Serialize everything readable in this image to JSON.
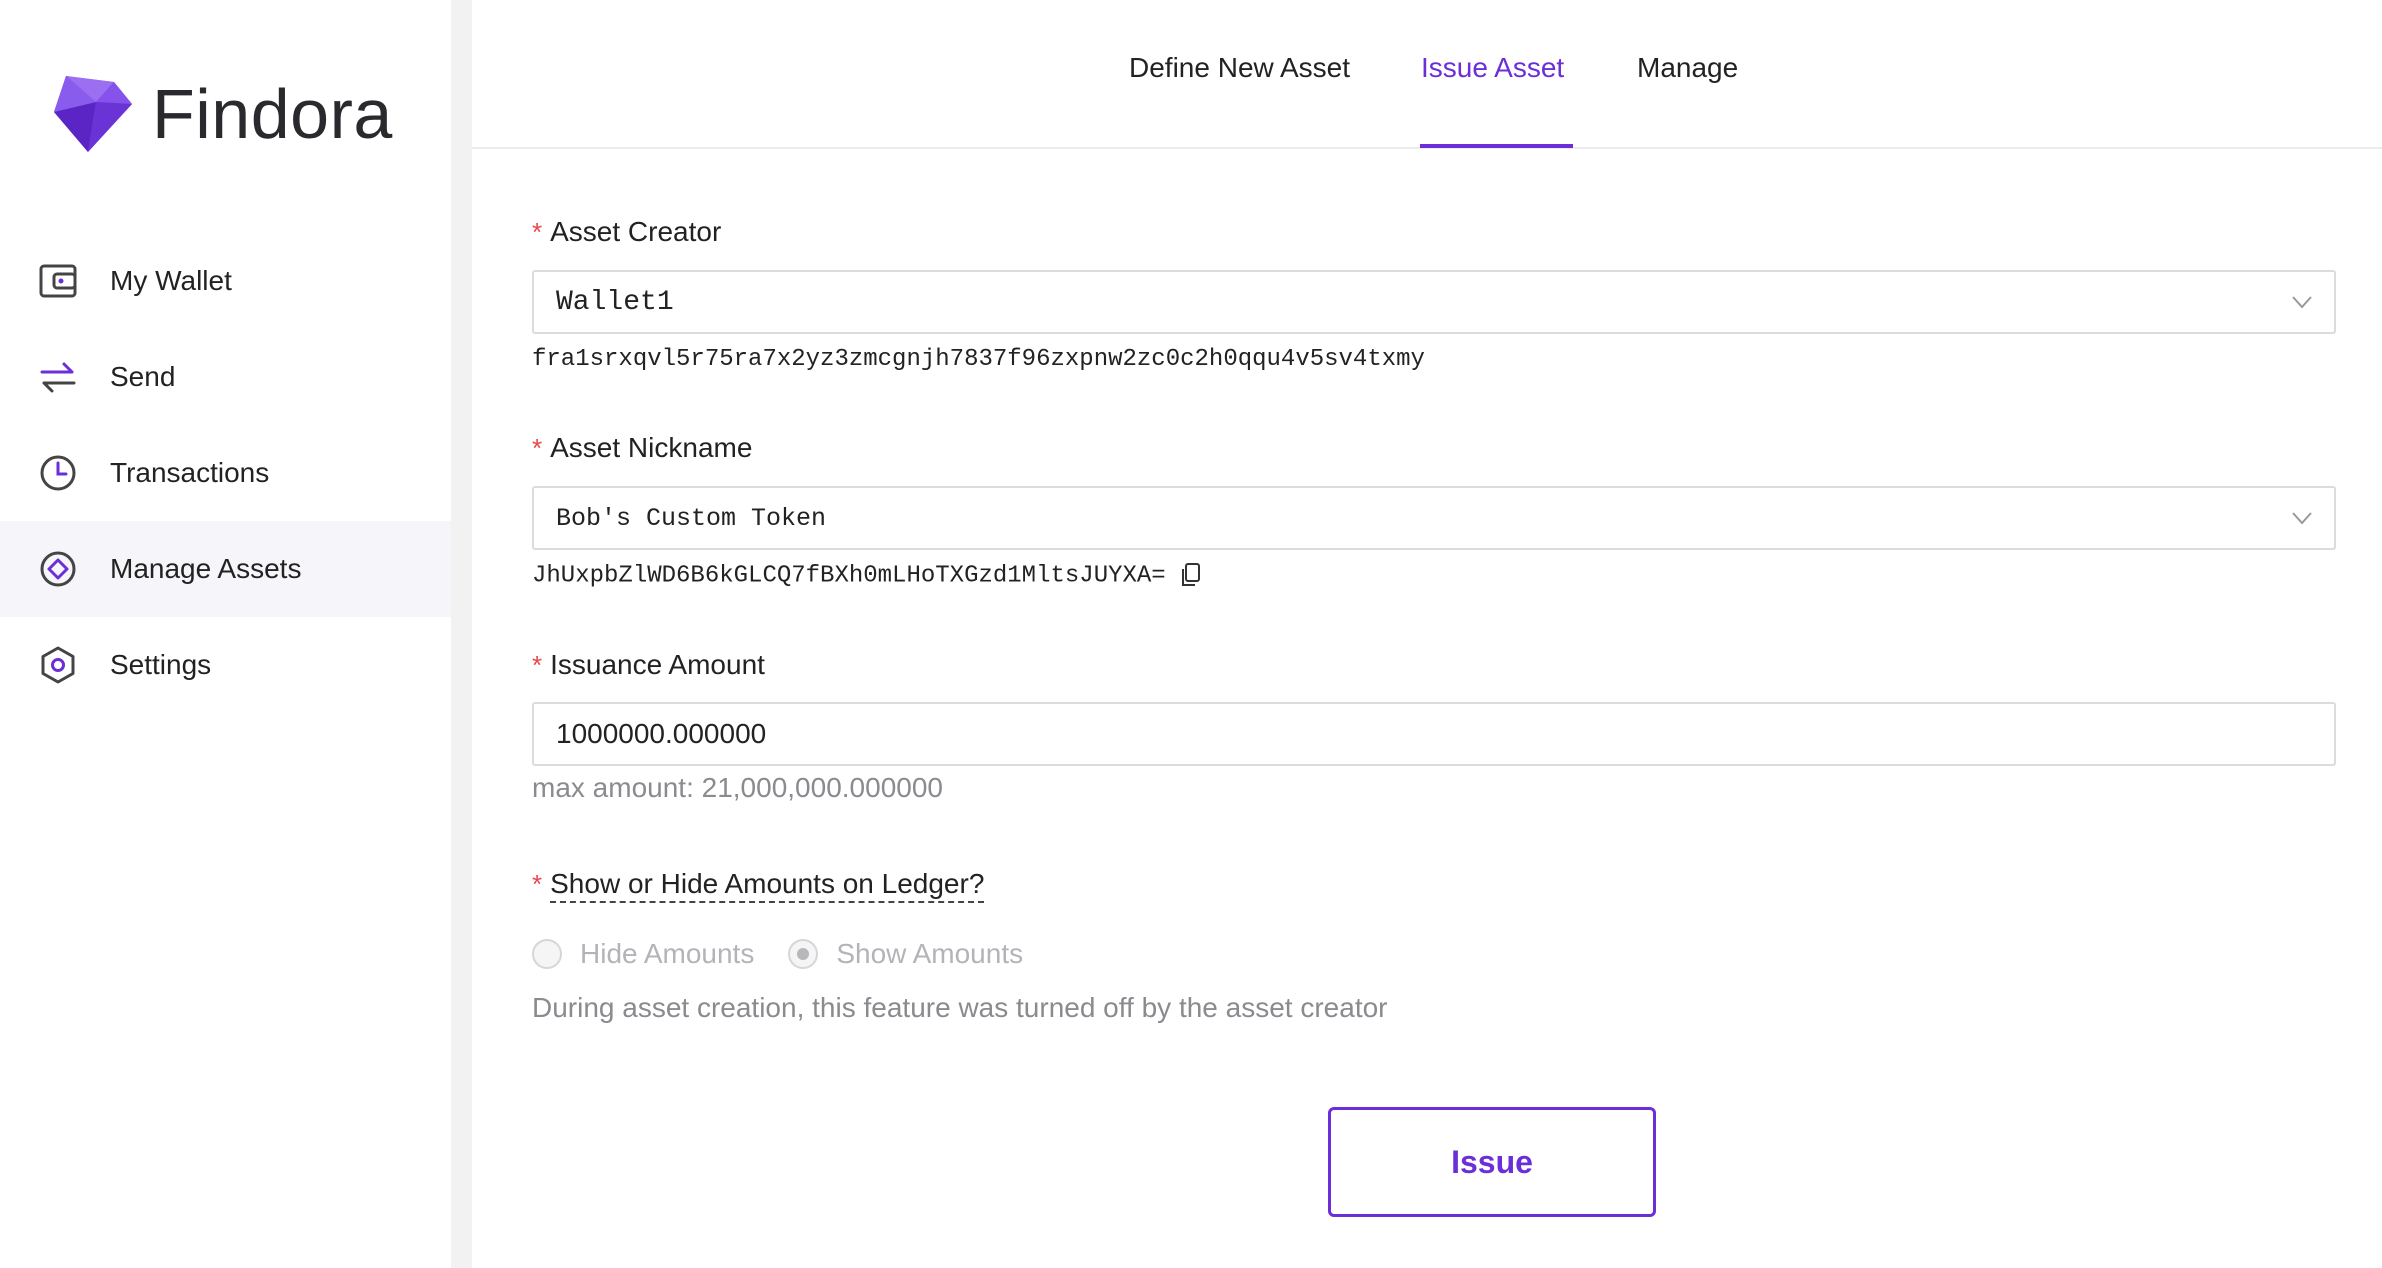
{
  "brand": {
    "name": "Findora",
    "accent": "#6b2ed8",
    "logo_icon": "findora-gem-icon"
  },
  "sidebar": {
    "items": [
      {
        "label": "My Wallet",
        "icon": "wallet-icon",
        "active": false
      },
      {
        "label": "Send",
        "icon": "transfer-arrows-icon",
        "active": false
      },
      {
        "label": "Transactions",
        "icon": "clock-icon",
        "active": false
      },
      {
        "label": "Manage Assets",
        "icon": "diamond-circle-icon",
        "active": true
      },
      {
        "label": "Settings",
        "icon": "hexagon-gear-icon",
        "active": false
      }
    ]
  },
  "tabs": [
    {
      "label": "Define New Asset",
      "active": false
    },
    {
      "label": "Issue Asset",
      "active": true
    },
    {
      "label": "Manage",
      "active": false
    }
  ],
  "form": {
    "asset_creator": {
      "label": "Asset Creator",
      "value": "Wallet1",
      "address": "fra1srxqvl5r75ra7x2yz3zmcgnjh7837f96zxpnw2zc0c2h0qqu4v5sv4txmy"
    },
    "asset_nickname": {
      "label": "Asset Nickname",
      "value": "Bob's Custom Token",
      "code": "JhUxpbZlWD6B6kGLCQ7fBXh0mLHoTXGzd1MltsJUYXA="
    },
    "issuance_amount": {
      "label": "Issuance Amount",
      "value": "1000000.000000",
      "max_hint": "max amount: 21,000,000.000000"
    },
    "visibility": {
      "label": "Show or Hide Amounts on Ledger?",
      "options": [
        "Hide Amounts",
        "Show Amounts"
      ],
      "selected": "Show Amounts",
      "note": "During asset creation, this feature was turned off by the asset creator"
    },
    "required_mark": "*",
    "submit_label": "Issue"
  }
}
